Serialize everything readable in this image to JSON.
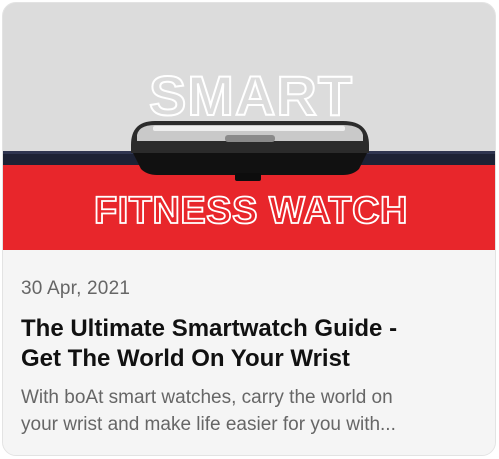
{
  "article": {
    "image": {
      "headline_top": "SMART",
      "headline_bottom": "FITNESS WATCH",
      "colors": {
        "top_band": "#dddddd",
        "bottom_band": "#e8262b",
        "outline_text": "#ffffff"
      }
    },
    "date": "30 Apr, 2021",
    "title_line1": "The Ultimate Smartwatch Guide -",
    "title_line2": "Get The World On Your Wrist",
    "excerpt_line1": "With boAt smart watches, carry the world on",
    "excerpt_line2": "your wrist and make life easier for you with..."
  }
}
